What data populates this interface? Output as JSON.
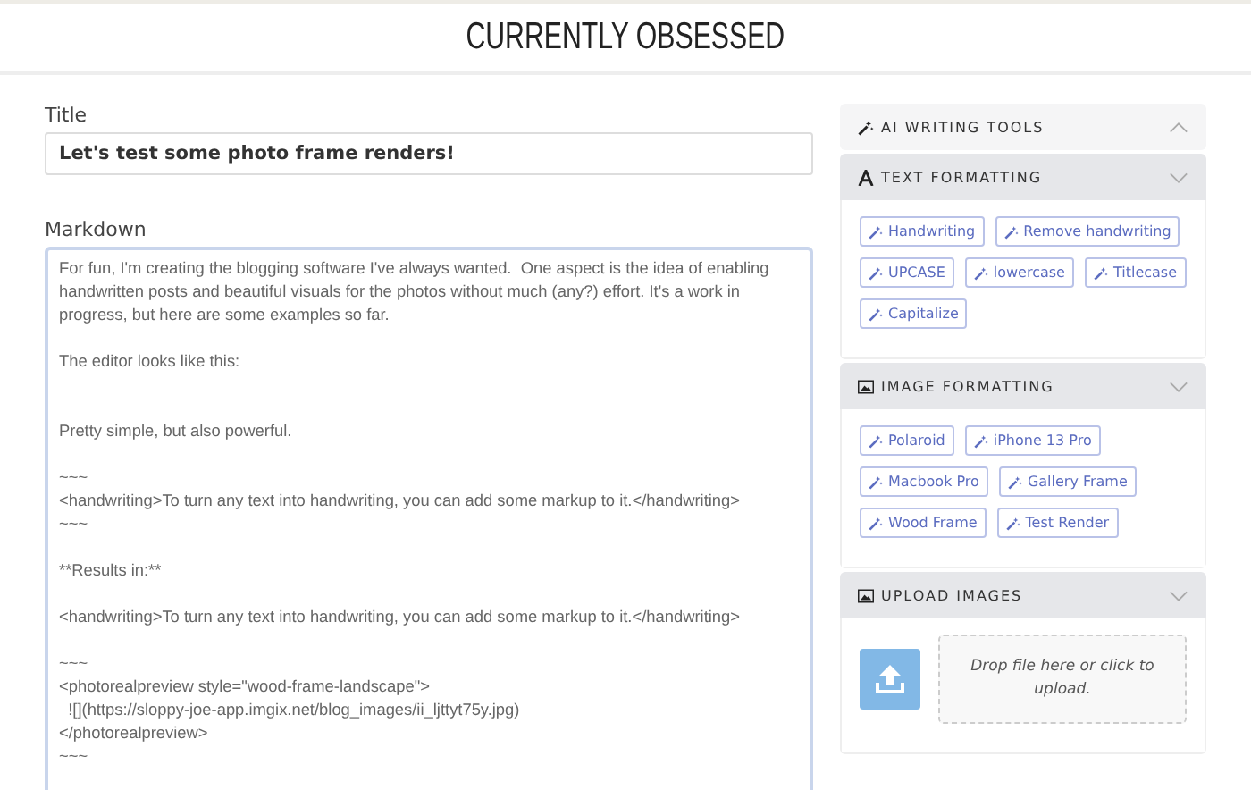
{
  "site_title": "CURRENTLY OBSESSED",
  "title_field": {
    "label": "Title",
    "value": "Let's test some photo frame renders!"
  },
  "markdown_field": {
    "label": "Markdown",
    "value": "For fun, I'm creating the blogging software I've always wanted.  One aspect is the idea of enabling handwritten posts and beautiful visuals for the photos without much (any?) effort. It's a work in progress, but here are some examples so far.\n\nThe editor looks like this:\n\n\nPretty simple, but also powerful.\n\n~~~\n<handwriting>To turn any text into handwriting, you can add some markup to it.</handwriting>\n~~~\n\n**Results in:**\n\n<handwriting>To turn any text into handwriting, you can add some markup to it.</handwriting>\n\n~~~\n<photorealpreview style=\"wood-frame-landscape\">\n  ![](https://sloppy-joe-app.imgix.net/blog_images/ii_ljttyt75y.jpg)\n</photorealpreview>\n~~~"
  },
  "panels": [
    {
      "kind": "wand",
      "title": "AI WRITING TOOLS",
      "expanded": false
    },
    {
      "kind": "text",
      "title": "TEXT FORMATTING",
      "expanded": true,
      "buttons": [
        "Handwriting",
        "Remove handwriting",
        "UPCASE",
        "lowercase",
        "Titlecase",
        "Capitalize"
      ]
    },
    {
      "kind": "image",
      "title": "IMAGE FORMATTING",
      "expanded": true,
      "buttons": [
        "Polaroid",
        "iPhone 13 Pro",
        "Macbook Pro",
        "Gallery Frame",
        "Wood Frame",
        "Test Render"
      ]
    },
    {
      "kind": "image",
      "title": "UPLOAD IMAGES",
      "expanded": true,
      "dropzone": "Drop file here or click to upload."
    }
  ]
}
